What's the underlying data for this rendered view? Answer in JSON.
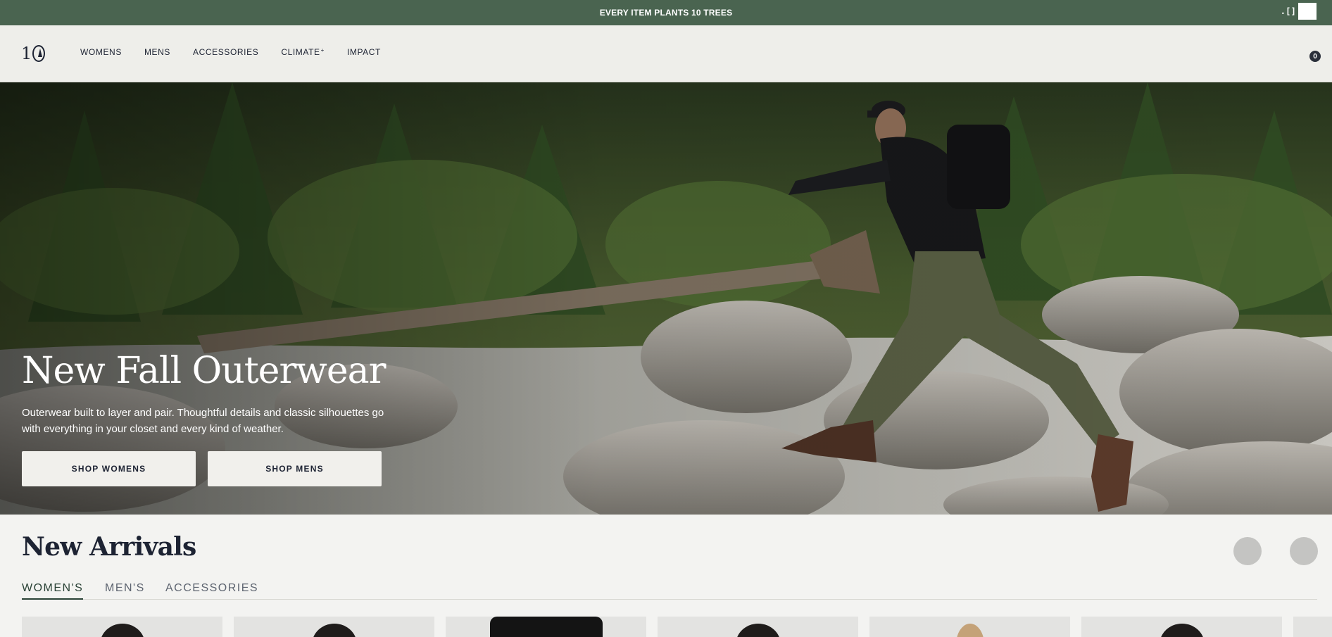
{
  "announcement": {
    "text": "EVERY ITEM PLANTS 10 TREES",
    "control_glyph": ".[]"
  },
  "header": {
    "logo_alt": "10",
    "nav": [
      {
        "label": "WOMENS"
      },
      {
        "label": "MENS"
      },
      {
        "label": "ACCESSORIES"
      },
      {
        "label": "CLIMATE",
        "suffix": "+"
      },
      {
        "label": "IMPACT"
      }
    ],
    "cart_count": "0"
  },
  "hero": {
    "title": "New Fall Outerwear",
    "subtitle": "Outerwear built to layer and pair. Thoughtful details and classic silhouettes go with everything in your closet and every kind of weather.",
    "shop_womens": "SHOP WOMENS",
    "shop_mens": "SHOP MENS"
  },
  "arrivals": {
    "title": "New Arrivals",
    "tabs": [
      {
        "label": "WOMEN'S",
        "active": true
      },
      {
        "label": "MEN'S",
        "active": false
      },
      {
        "label": "ACCESSORIES",
        "active": false
      }
    ]
  },
  "colors": {
    "announcement_bg": "#4a6450",
    "header_bg": "#eeeeea",
    "page_bg": "#f3f3f1",
    "text_dark": "#1d2333",
    "tab_active": "#2a4236"
  }
}
